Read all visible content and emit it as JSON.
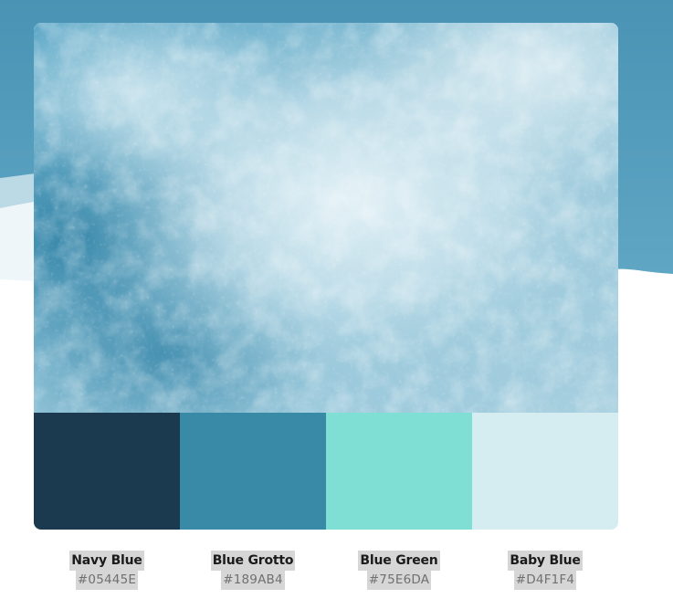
{
  "palette": [
    {
      "name": "Navy Blue",
      "hex": "#05445E",
      "color": "#1b3a4f"
    },
    {
      "name": "Blue Grotto",
      "hex": "#189AB4",
      "color": "#388aa6"
    },
    {
      "name": "Blue Green",
      "hex": "#75E6DA",
      "color": "#7fdfd4"
    },
    {
      "name": "Baby Blue",
      "hex": "#D4F1F4",
      "color": "#d5edf1"
    }
  ],
  "colors": {
    "background_band": "#4e97b7",
    "background_band_light": "#e9f3f7",
    "page": "#ffffff"
  }
}
